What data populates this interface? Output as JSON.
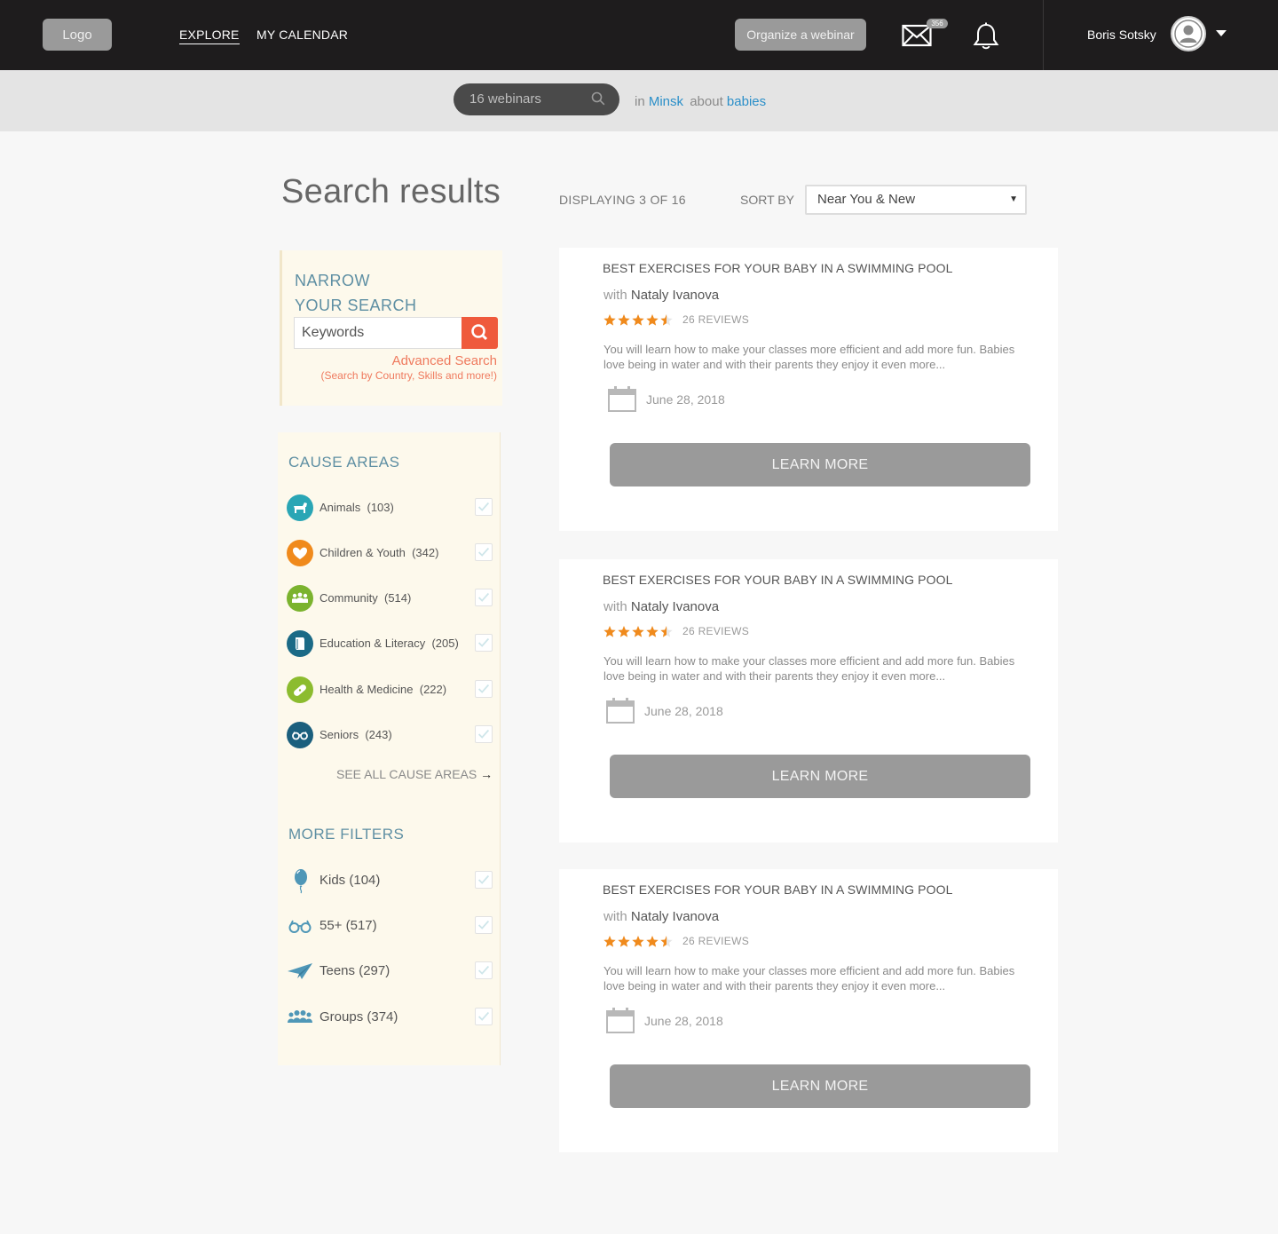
{
  "header": {
    "logo": "Logo",
    "nav": [
      "EXPLORE",
      "MY CALENDAR"
    ],
    "organize_label": "Organize a webinar",
    "mail_count": "356",
    "user_name": "Boris Sotsky"
  },
  "search_band": {
    "query": "16 webinars",
    "in_word": "in",
    "location": "Minsk",
    "about_word": "about",
    "topic": "babies"
  },
  "results": {
    "title": "Search results",
    "displaying": "DISPLAYING 3 OF 16",
    "sort_label": "SORT BY",
    "sort_value": "Near You & New"
  },
  "narrow": {
    "title_line1": "NARROW",
    "title_line2": "YOUR SEARCH",
    "keywords_placeholder": "Keywords",
    "advanced": "Advanced Search",
    "advanced_sub": "(Search by Country, Skills and more!)"
  },
  "cause_areas": {
    "title": "CAUSE AREAS",
    "items": [
      {
        "label": "Animals",
        "count": "(103)",
        "color": "#2aa6b5",
        "icon": "horse-icon"
      },
      {
        "label": "Children & Youth",
        "count": "(342)",
        "color": "#f08a1c",
        "icon": "heart-hands-icon"
      },
      {
        "label": "Community",
        "count": "(514)",
        "color": "#7bb32e",
        "icon": "people-icon"
      },
      {
        "label": "Education & Literacy",
        "count": "(205)",
        "color": "#1b6a86",
        "icon": "book-icon"
      },
      {
        "label": "Health & Medicine",
        "count": "(222)",
        "color": "#8cbc2f",
        "icon": "bandage-icon"
      },
      {
        "label": "Seniors",
        "count": "(243)",
        "color": "#1b5f7d",
        "icon": "glasses-icon"
      }
    ],
    "see_all": "SEE ALL CAUSE AREAS"
  },
  "more_filters": {
    "title": "MORE FILTERS",
    "items": [
      {
        "label": "Kids",
        "count": "(104)",
        "icon": "balloon-icon"
      },
      {
        "label": "55+",
        "count": "(517)",
        "icon": "glasses-icon"
      },
      {
        "label": "Teens",
        "count": "(297)",
        "icon": "paper-plane-icon"
      },
      {
        "label": "Groups",
        "count": "(374)",
        "icon": "group-icon"
      }
    ]
  },
  "cards": [
    {
      "title": "BEST EXERCISES FOR YOUR BABY IN A SWIMMING POOL",
      "with": "with",
      "author": "Nataly Ivanova",
      "rating": 4.5,
      "reviews": "26 REVIEWS",
      "desc": "You will learn how to make your classes more efficient and add more fun. Babies love being in water and with their parents they enjoy it even more...",
      "date": "June 28, 2018",
      "cta": "LEARN MORE"
    },
    {
      "title": "BEST EXERCISES FOR YOUR BABY IN A SWIMMING POOL",
      "with": "with",
      "author": "Nataly Ivanova",
      "rating": 4.5,
      "reviews": "26 REVIEWS",
      "desc": "You will learn how to make your classes more efficient and add more fun. Babies love being in water and with their parents they enjoy it even more...",
      "date": "June 28, 2018",
      "cta": "LEARN MORE"
    },
    {
      "title": "BEST EXERCISES FOR YOUR BABY IN A SWIMMING POOL",
      "with": "with",
      "author": "Nataly Ivanova",
      "rating": 4.5,
      "reviews": "26 REVIEWS",
      "desc": "You will learn how to make your classes more efficient and add more fun. Babies love being in water and with their parents they enjoy it even more...",
      "date": "June 28, 2018",
      "cta": "LEARN MORE"
    }
  ]
}
